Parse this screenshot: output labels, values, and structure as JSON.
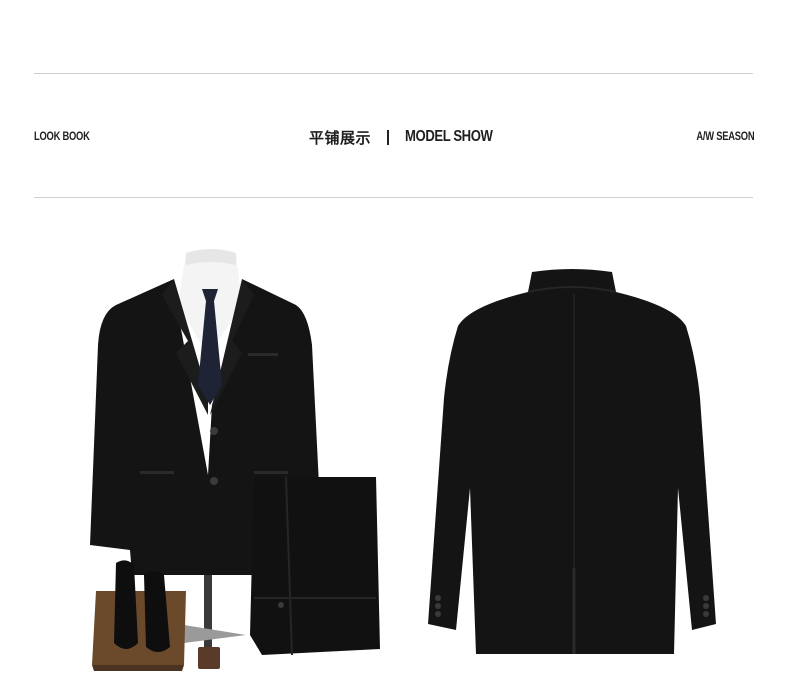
{
  "header": {
    "left_label": "LOOK BOOK",
    "title_cn": "平铺展示",
    "title_en": "MODEL SHOW",
    "right_label": "A/W SEASON"
  },
  "photos": {
    "front": "suit-front-with-trousers-and-shoes",
    "back": "suit-jacket-back"
  },
  "colors": {
    "suit": "#141414",
    "tie": "#1e2436",
    "shirt": "#f4f4f4",
    "rule": "#cfcfcf",
    "shoe_box": "#6b4a2c"
  }
}
